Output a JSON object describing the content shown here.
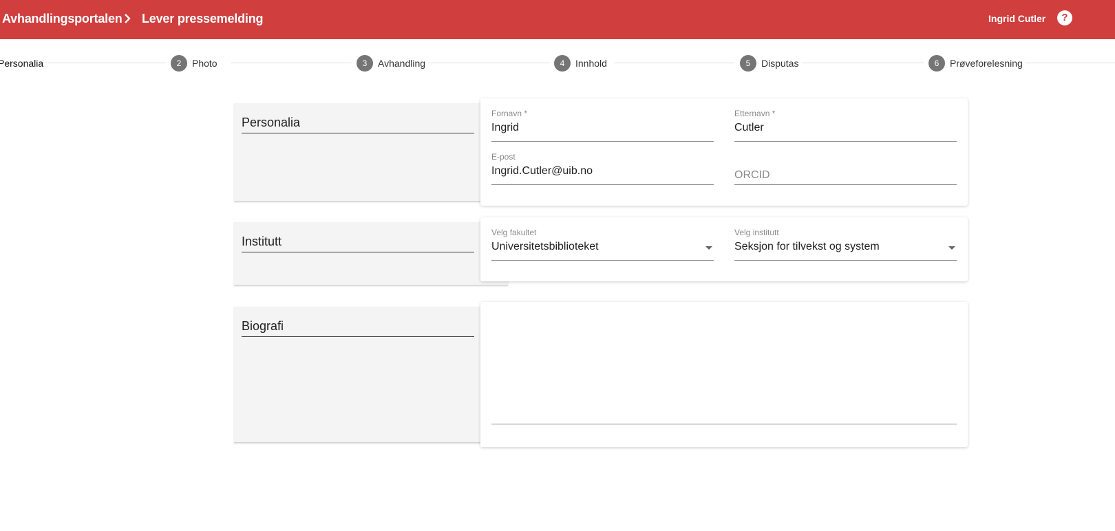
{
  "header": {
    "root_label": "Avhandlingsportalen",
    "current_label": "Lever pressemelding",
    "user_name": "Ingrid Cutler",
    "help_glyph": "?"
  },
  "stepper": {
    "steps": [
      {
        "number": "",
        "label": "Personalia"
      },
      {
        "number": "2",
        "label": "Photo"
      },
      {
        "number": "3",
        "label": "Avhandling"
      },
      {
        "number": "4",
        "label": "Innhold"
      },
      {
        "number": "5",
        "label": "Disputas"
      },
      {
        "number": "6",
        "label": "Prøveforelesning"
      }
    ]
  },
  "personalia": {
    "title": "Personalia",
    "fornavn": {
      "label": "Fornavn *",
      "value": "Ingrid"
    },
    "etternavn": {
      "label": "Etternavn *",
      "value": "Cutler"
    },
    "epost": {
      "label": "E-post",
      "value": "Ingrid.Cutler@uib.no"
    },
    "orcid": {
      "placeholder": "ORCID"
    }
  },
  "institutt": {
    "title": "Institutt",
    "fakultet": {
      "label": "Velg fakultet",
      "value": "Universitetsbiblioteket"
    },
    "institutt": {
      "label": "Velg institutt",
      "value": "Seksjon for tilvekst og system"
    }
  },
  "biografi": {
    "title": "Biografi",
    "value": ""
  },
  "colors": {
    "header_bg": "#d03e3e",
    "step_circle": "#757575",
    "section_bg": "#f4f4f4"
  },
  "icons": [
    "chevron-right-icon",
    "help-icon",
    "dropdown-arrow-icon"
  ]
}
